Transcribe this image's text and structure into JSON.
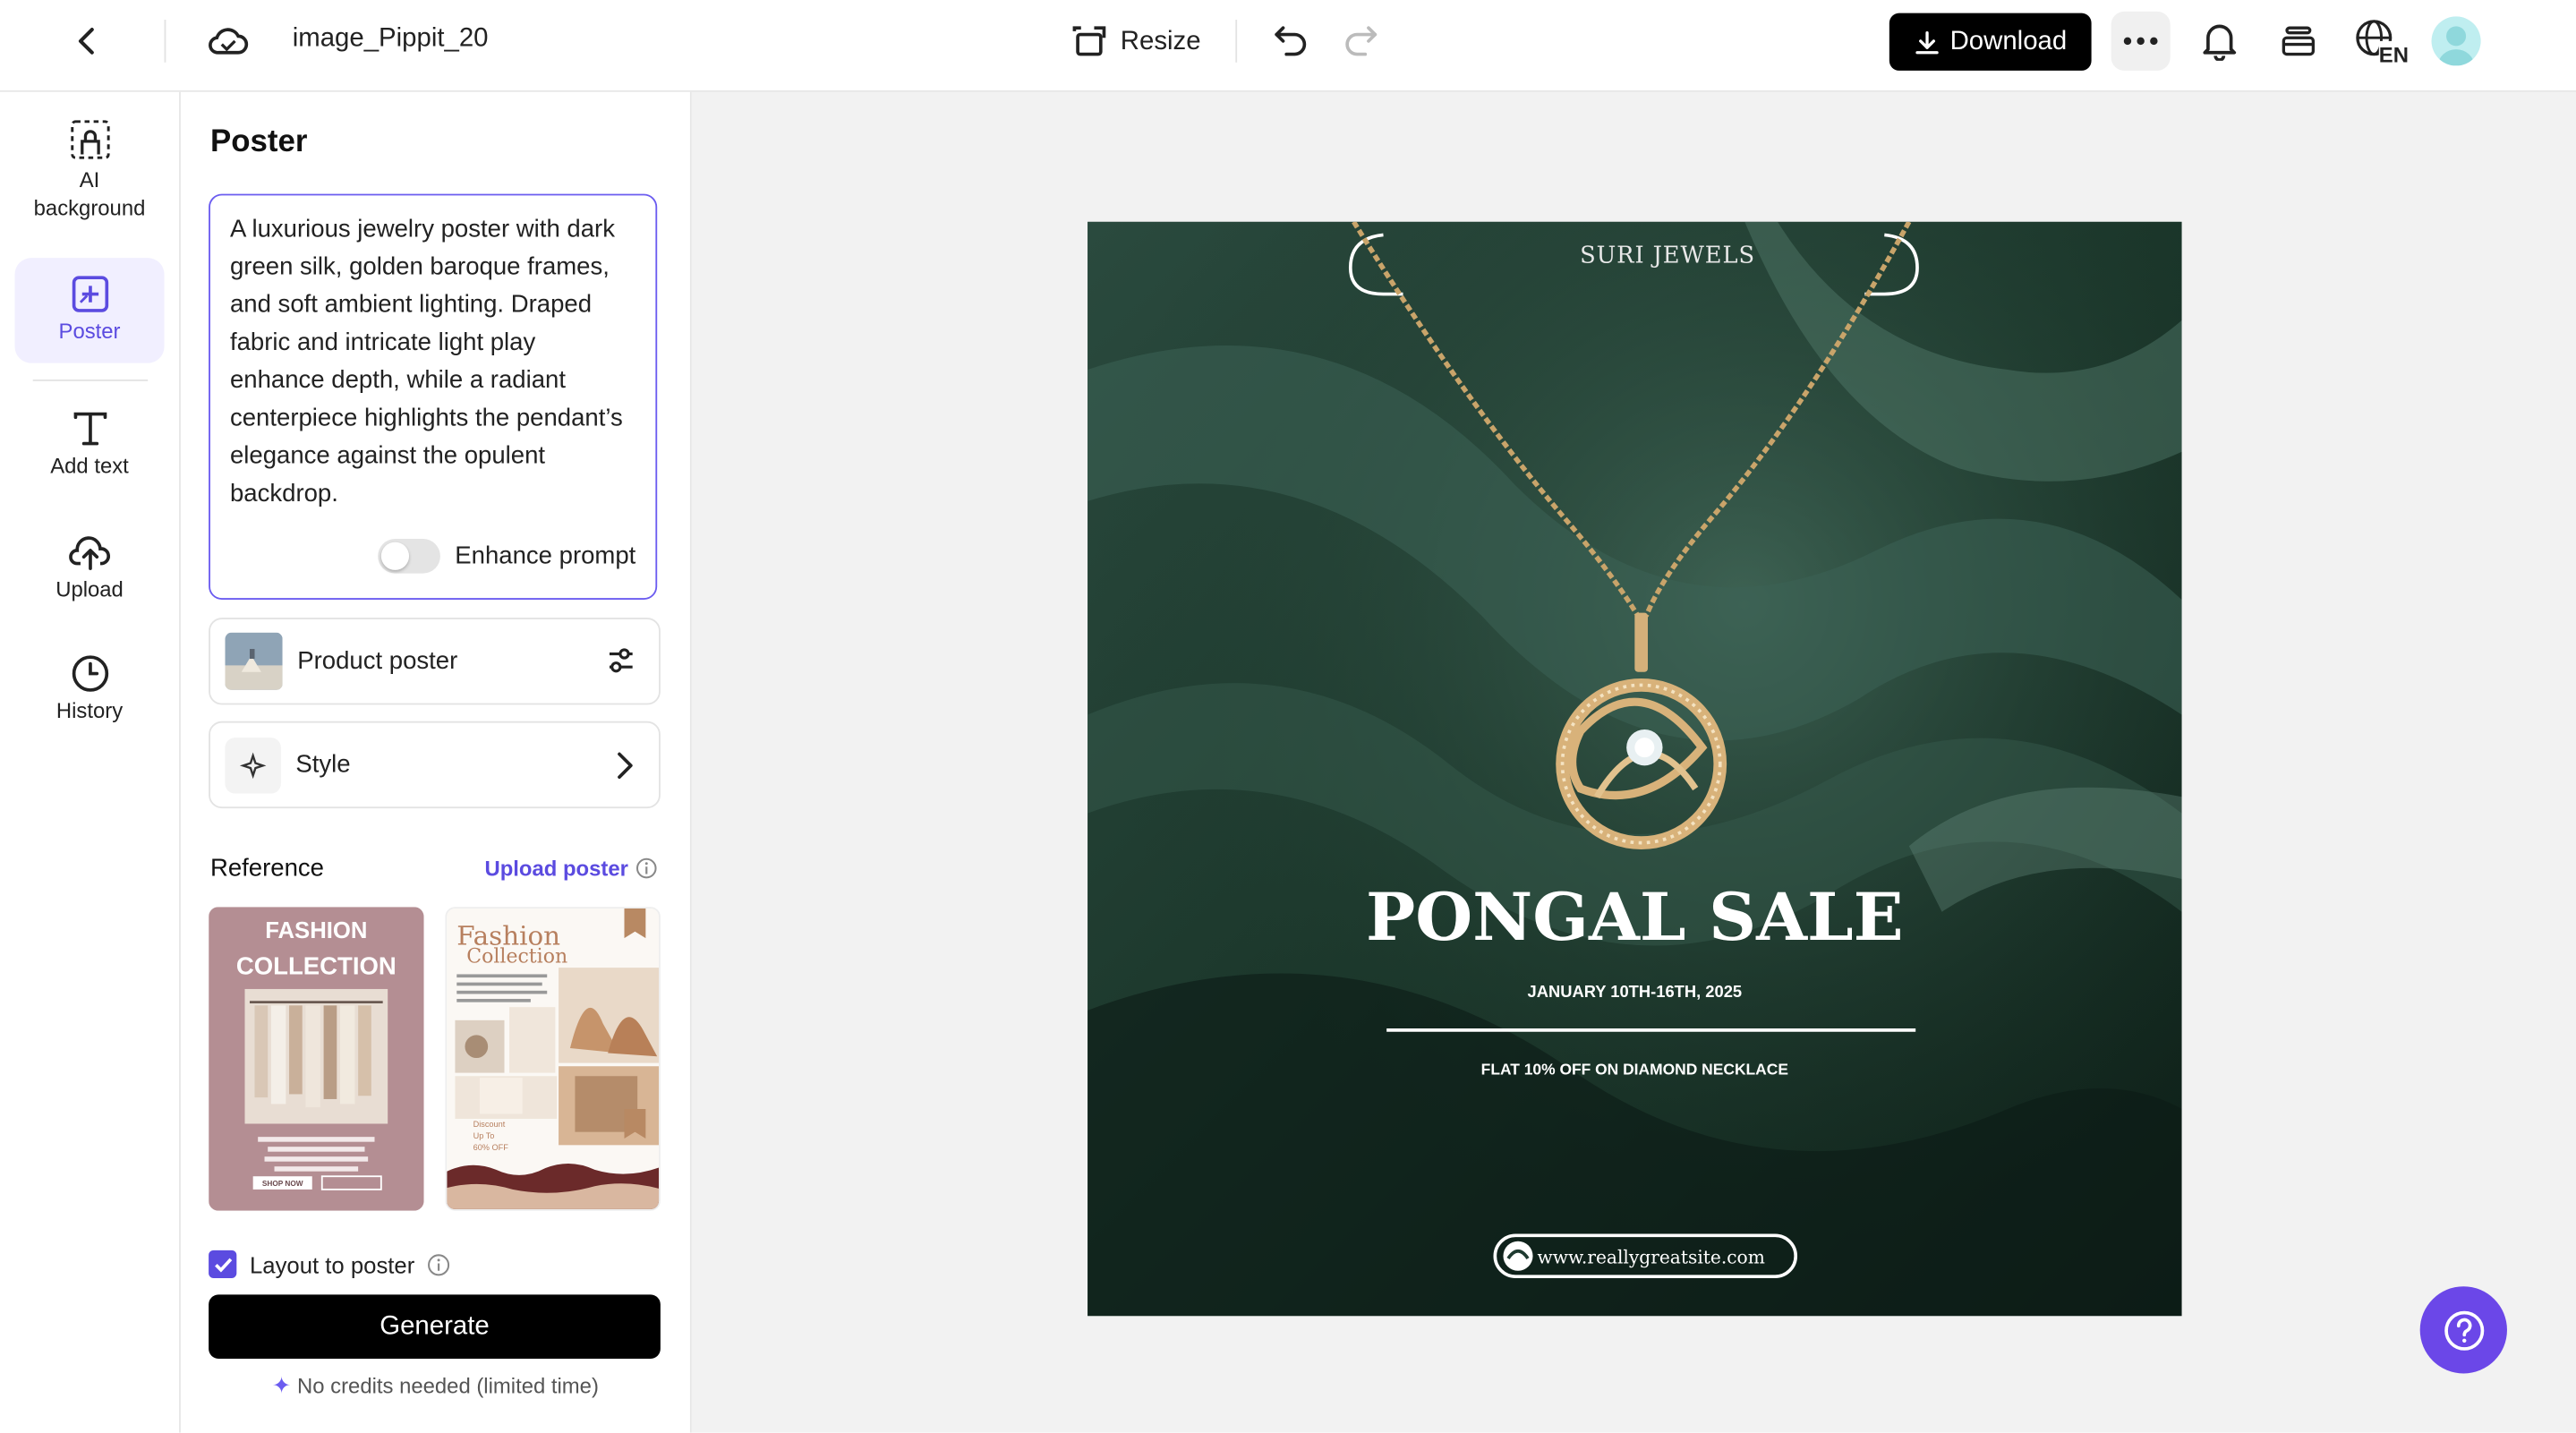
{
  "header": {
    "doc_title": "image_Pippit_20",
    "resize_label": "Resize",
    "download_label": "Download",
    "language": "EN"
  },
  "rail": {
    "items": [
      {
        "label": "AI background",
        "icon": "ai-background-icon"
      },
      {
        "label": "Poster",
        "icon": "poster-icon",
        "active": true
      },
      {
        "label": "Add text",
        "icon": "text-icon"
      },
      {
        "label": "Upload",
        "icon": "upload-icon"
      },
      {
        "label": "History",
        "icon": "history-icon"
      }
    ]
  },
  "panel": {
    "title": "Poster",
    "prompt": "A luxurious jewelry poster with dark green silk, golden baroque frames, and soft ambient lighting. Draped fabric and intricate light play enhance depth, while a radiant centerpiece highlights the pendant’s elegance against the opulent backdrop.",
    "enhance_label": "Enhance prompt",
    "product_poster_label": "Product poster",
    "style_label": "Style",
    "reference_label": "Reference",
    "upload_poster_label": "Upload poster",
    "layout_label": "Layout to poster",
    "generate_label": "Generate",
    "credits_note": "No credits needed (limited time)",
    "ref1": {
      "title": "FASHION\nCOLLECTION",
      "title_line1": "FASHION",
      "title_line2": "COLLECTION",
      "shop_now": "SHOP NOW"
    },
    "ref2": {
      "title_line1": "Fashion",
      "title_line2": "Collection",
      "discount_line1": "Discount",
      "discount_line2": "Up To",
      "discount_line3": "60% OFF"
    }
  },
  "poster": {
    "brand": "SURI JEWELS",
    "headline": "PONGAL SALE",
    "dates": "JANUARY 10TH-16TH, 2025",
    "offer": "FLAT 10% OFF ON DIAMOND NECKLACE",
    "website": "www.reallygreatsite.com"
  },
  "colors": {
    "accent": "#5b4be0",
    "help_button": "#6b47e8",
    "poster_bg": "#1e3a30"
  }
}
